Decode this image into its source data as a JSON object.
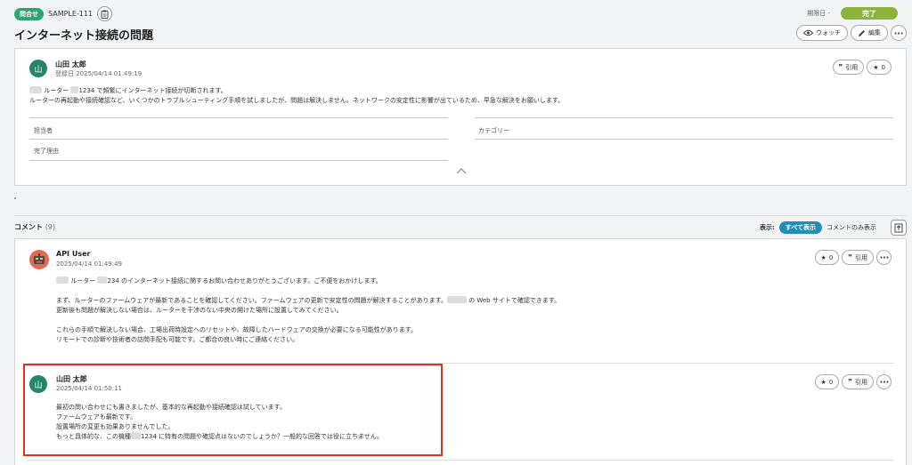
{
  "header": {
    "type_badge": "問合せ",
    "issue_key": "SAMPLE-111",
    "due_label": "期限日 -",
    "status": "完了",
    "title": "インターネット接続の問題",
    "watch_label": "ウォッチ",
    "edit_label": "編集"
  },
  "issue": {
    "avatar_char": "山",
    "author": "山田 太郎",
    "registered": "登録日 2025/04/14 01:49:19",
    "quote_label": "引用",
    "star_count": "0",
    "desc_line1_a": "ルーター",
    "desc_line1_b": "1234 で頻繁にインターネット接続が切断されます。",
    "desc_line2": "ルーターの再起動や接続確認など、いくつかのトラブルシューティング手順を試しましたが、問題は解決しません。ネットワークの安定性に影響が出ているため、早急な解決をお願いします。",
    "field_assignee": "担当者",
    "field_category": "カテゴリー",
    "field_resolution": "完了理由"
  },
  "comments": {
    "title": "コメント",
    "count": "(9)",
    "view_label": "表示:",
    "view_all": "すべて表示",
    "view_only": "コメントのみ表示",
    "items": [
      {
        "author": "API User",
        "date": "2025/04/14 01:49:49",
        "star_count": "0",
        "quote_label": "引用",
        "line1_a": "ルーター",
        "line1_b": "234 のインターネット接続に関するお問い合わせありがとうございます。ご不便をおかけします。",
        "line2_a": "まず、ルーターのファームウェアが最新であることを確認してください。ファームウェアの更新で安定性の問題が解決することがあります。",
        "line2_b": "の Web サイトで確認できます。",
        "line3": "更新後も問題が解決しない場合は、ルーターを干渉のない中央の開けた場所に設置してみてください。",
        "line4": "これらの手順で解決しない場合、工場出荷時設定へのリセットや、故障したハードウェアの交換が必要になる可能性があります。",
        "line5": "リモートでの診断や技術者の訪問手配も可能です。ご都合の良い時にご連絡ください。"
      },
      {
        "avatar_char": "山",
        "author": "山田 太郎",
        "date": "2025/04/14 01:50:11",
        "star_count": "0",
        "quote_label": "引用",
        "line1": "最初の問い合わせにも書きましたが、基本的な再起動や接続確認は試しています。",
        "line2": "ファームウェアも最新です。",
        "line3": "設置場所の変更も効果ありませんでした。",
        "line4_a": "もっと具体的な、この機種",
        "line4_b": "1234 に特有の問題や確認点はないのでしょうか？一般的な回答では役に立ちません。"
      }
    ]
  }
}
